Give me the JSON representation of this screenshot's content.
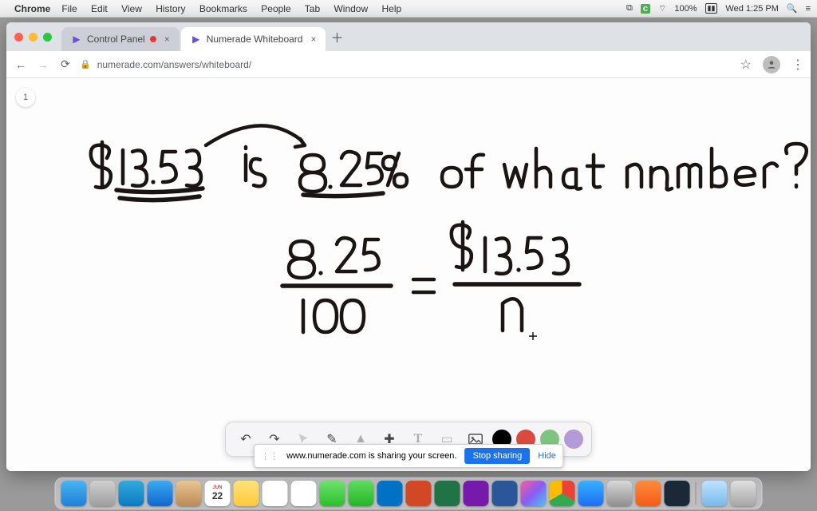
{
  "menubar": {
    "app": "Chrome",
    "items": [
      "File",
      "Edit",
      "View",
      "History",
      "Bookmarks",
      "People",
      "Tab",
      "Window",
      "Help"
    ],
    "battery": "100%",
    "clock": "Wed 1:25 PM"
  },
  "tabs": {
    "t1": {
      "title": "Control Panel"
    },
    "t2": {
      "title": "Numerade Whiteboard"
    }
  },
  "address": "numerade.com/answers/whiteboard/",
  "page_number": "1",
  "whiteboard": {
    "line1": "$13.53  is  8.25%  of what number?",
    "equation": "8.25 / 100 = $13.53 / n"
  },
  "sharebar": {
    "msg": "www.numerade.com is sharing your screen.",
    "stop": "Stop sharing",
    "hide": "Hide"
  },
  "colors": {
    "swatches": [
      "#000000",
      "#d94b3f",
      "#7cc47f",
      "#b49bd8"
    ]
  }
}
